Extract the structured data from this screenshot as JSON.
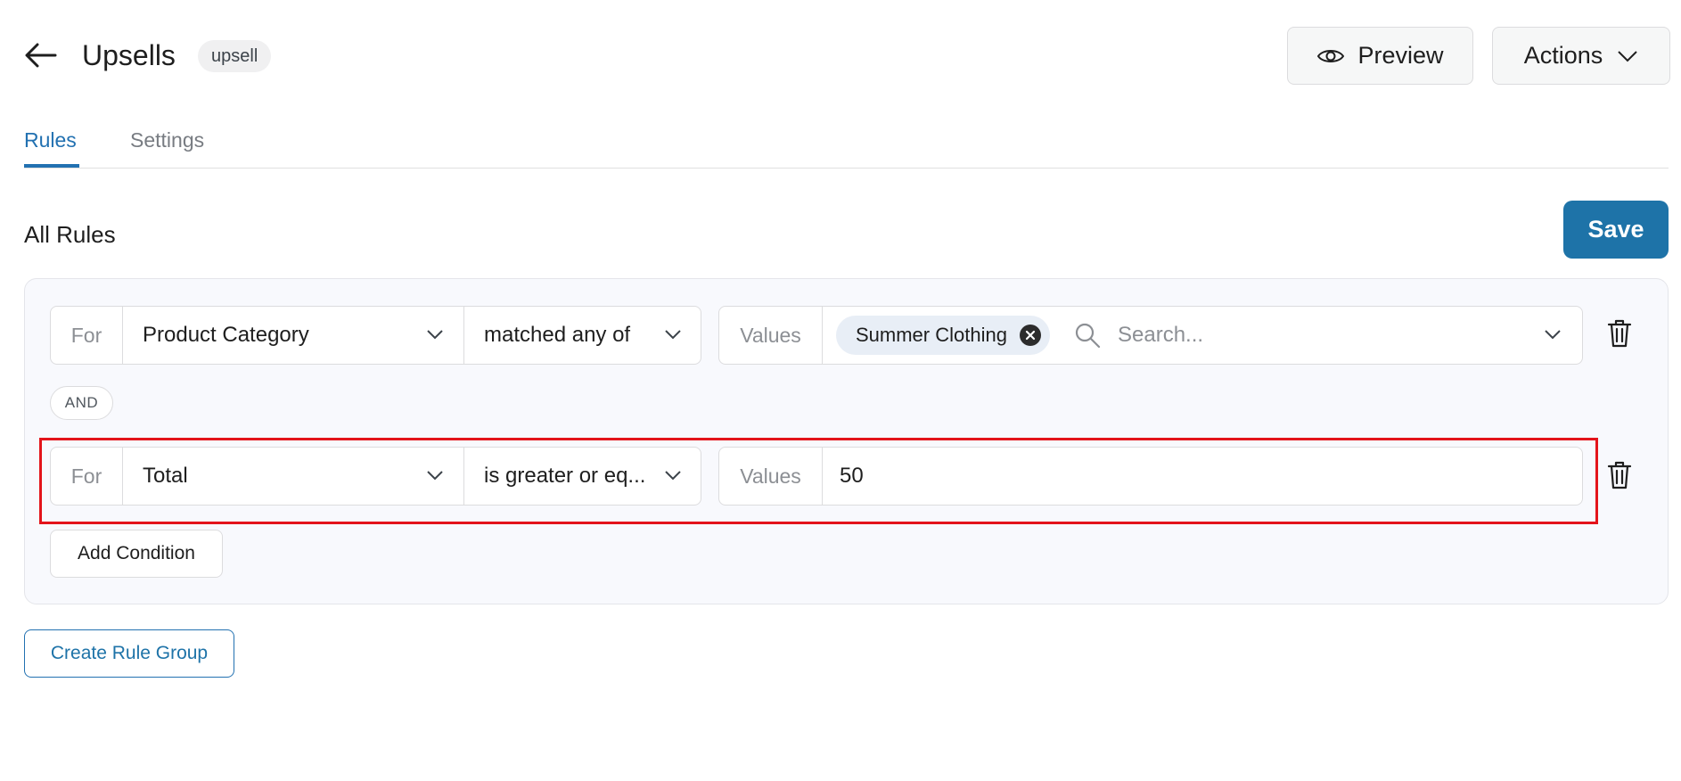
{
  "header": {
    "title": "Upsells",
    "badge": "upsell",
    "preview_label": "Preview",
    "actions_label": "Actions"
  },
  "tabs": [
    {
      "label": "Rules",
      "active": true
    },
    {
      "label": "Settings",
      "active": false
    }
  ],
  "section": {
    "title": "All Rules",
    "save_label": "Save"
  },
  "rule_group": {
    "conditions": [
      {
        "for_label": "For",
        "field": "Product Category",
        "operator": "matched any of",
        "values_label": "Values",
        "chips": [
          "Summer Clothing"
        ],
        "search_placeholder": "Search..."
      },
      {
        "for_label": "For",
        "field": "Total",
        "operator": "is greater or eq...",
        "values_label": "Values",
        "value": "50",
        "highlighted": true
      }
    ],
    "joiner": "AND",
    "add_condition_label": "Add Condition"
  },
  "create_rule_group_label": "Create Rule Group",
  "colors": {
    "accent": "#2271b1",
    "save_button": "#1e73a8",
    "highlight_border": "#e3141b",
    "chip_bg": "#e8eef6",
    "group_bg": "#f8f9fd"
  },
  "icons": [
    "arrow-left-icon",
    "eye-icon",
    "chevron-down-icon",
    "close-circle-icon",
    "search-icon",
    "trash-icon"
  ]
}
